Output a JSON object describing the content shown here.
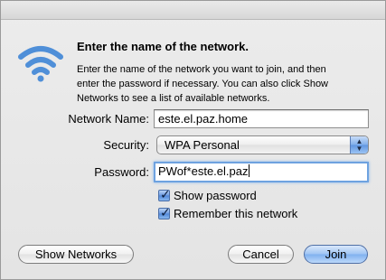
{
  "dialog": {
    "heading": "Enter the name of the network.",
    "description": "Enter the name of the network you want to join, and then\nenter the password if necessary. You can also click Show\nNetworks to see a list of available networks."
  },
  "form": {
    "network_name_label": "Network Name:",
    "network_name_value": "este.el.paz.home",
    "security_label": "Security:",
    "security_value": "WPA Personal",
    "password_label": "Password:",
    "password_value": "PWof*este.el.paz",
    "show_password_label": "Show password",
    "show_password_checked": true,
    "remember_label": "Remember this network",
    "remember_checked": true
  },
  "buttons": {
    "show_networks": "Show Networks",
    "cancel": "Cancel",
    "join": "Join"
  },
  "colors": {
    "accent": "#6ea2e0",
    "wifi": "#4f8fd8"
  },
  "icons": {
    "wifi": "wifi-icon",
    "popup_arrows": "updown-arrows-icon",
    "checkmark": "checkmark-icon"
  }
}
